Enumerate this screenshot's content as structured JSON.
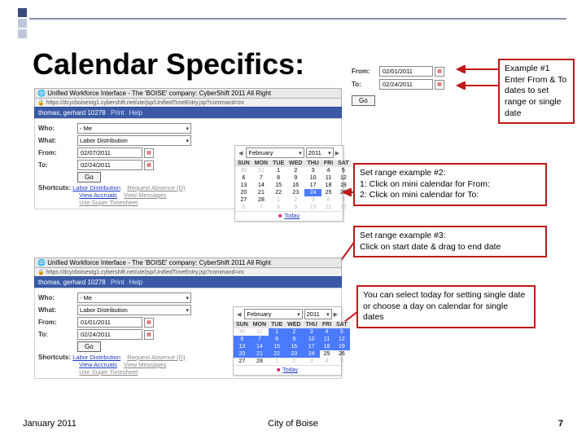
{
  "title": "Calendar Specifics:",
  "footer": {
    "date": "January 2011",
    "city": "City of Boise",
    "page": "7"
  },
  "ann1": "Example #1\nEnter From & To dates to set range or single date",
  "ann2": "Set range example #2:\n1:  Click on mini calendar for From:\n2:  Click on mini calendar for To:",
  "ann3": "Set range example #3:\nClick on start date & drag to end date",
  "ann4": "You can select today for setting single date or choose a day on calendar for single dates",
  "shot_top": {
    "ie_title": "Unified Workforce Interface - The 'BOISE' company: CyberShift 2011 All Right",
    "url": "https://dcycboisestg1.cybershift.net/ute/jsp/UnifiedTimeEntry.jsp?command=ini",
    "user": "thomas, gerhard 10278",
    "user_links": [
      "Print",
      "Help"
    ],
    "who_label": "Who:",
    "who_value": "- Me",
    "what_label": "What:",
    "what_value": "Labor Distribution",
    "from_label": "From:",
    "from_value": "02/07/2011",
    "to_label": "To:",
    "to_value": "02/24/2011",
    "go": "Go",
    "sc_label": "Shortcuts:",
    "sc_links": [
      "Labor Distribution",
      "Request Absence (D)",
      "View Accruals",
      "View Messages",
      "Use Super Timesheet"
    ]
  },
  "cal1": {
    "month": "February",
    "year": "2011",
    "dow": [
      "SUN",
      "MON",
      "TUE",
      "WED",
      "THU",
      "FRI",
      "SAT"
    ],
    "rows": [
      [
        {
          "d": "30",
          "off": 1
        },
        {
          "d": "31",
          "off": 1
        },
        {
          "d": "1"
        },
        {
          "d": "2"
        },
        {
          "d": "3"
        },
        {
          "d": "4"
        },
        {
          "d": "5"
        }
      ],
      [
        {
          "d": "6"
        },
        {
          "d": "7"
        },
        {
          "d": "8"
        },
        {
          "d": "9"
        },
        {
          "d": "10"
        },
        {
          "d": "11"
        },
        {
          "d": "12"
        }
      ],
      [
        {
          "d": "13"
        },
        {
          "d": "14"
        },
        {
          "d": "15"
        },
        {
          "d": "16"
        },
        {
          "d": "17"
        },
        {
          "d": "18"
        },
        {
          "d": "19"
        }
      ],
      [
        {
          "d": "20"
        },
        {
          "d": "21"
        },
        {
          "d": "22"
        },
        {
          "d": "23"
        },
        {
          "d": "24",
          "sel": 1
        },
        {
          "d": "25"
        },
        {
          "d": "26"
        }
      ],
      [
        {
          "d": "27"
        },
        {
          "d": "28"
        },
        {
          "d": "1",
          "off": 1
        },
        {
          "d": "2",
          "off": 1
        },
        {
          "d": "3",
          "off": 1
        },
        {
          "d": "4",
          "off": 1
        },
        {
          "d": "5",
          "off": 1
        }
      ],
      [
        {
          "d": "6",
          "off": 1
        },
        {
          "d": "7",
          "off": 1
        },
        {
          "d": "8",
          "off": 1
        },
        {
          "d": "9",
          "off": 1
        },
        {
          "d": "10",
          "off": 1
        },
        {
          "d": "11",
          "off": 1
        },
        {
          "d": "12",
          "off": 1
        }
      ]
    ],
    "today": "Today"
  },
  "frag": {
    "from_label": "From:",
    "from_value": "02/01/2011",
    "to_label": "To:",
    "to_value": "02/24/2011",
    "go": "Go"
  },
  "shot_bot": {
    "ie_title": "Unified Workforce Interface - The 'BOISE' company: CyberShift 2011 All Right",
    "url": "https://dcycboisestg1.cybershift.net/ute/jsp/UnifiedTimeEntry.jsp?command=ini",
    "user": "thomas, gerhard 10278",
    "user_links": [
      "Print",
      "Help"
    ],
    "who_label": "Who:",
    "who_value": "- Me",
    "what_label": "What:",
    "what_value": "Labor Distribution",
    "from_label": "From:",
    "from_value": "01/01/2011",
    "to_label": "To:",
    "to_value": "02/24/2011",
    "go": "Go",
    "sc_label": "Shortcuts:",
    "sc_links": [
      "Labor Distribution",
      "Request Absence (D)",
      "View Accruals",
      "View Messages",
      "Use Super Timesheet"
    ]
  },
  "cal2": {
    "month": "February",
    "year": "2011",
    "dow": [
      "SUN",
      "MON",
      "TUE",
      "WED",
      "THU",
      "FRI",
      "SAT"
    ],
    "rows": [
      [
        {
          "d": "30",
          "off": 1
        },
        {
          "d": "31",
          "off": 1
        },
        {
          "d": "1",
          "sel": 1
        },
        {
          "d": "2",
          "sel": 1
        },
        {
          "d": "3",
          "sel": 1
        },
        {
          "d": "4",
          "sel": 1
        },
        {
          "d": "5",
          "sel": 1
        }
      ],
      [
        {
          "d": "6",
          "sel": 1
        },
        {
          "d": "7",
          "sel": 1
        },
        {
          "d": "8",
          "sel": 1
        },
        {
          "d": "9",
          "sel": 1
        },
        {
          "d": "10",
          "sel": 1
        },
        {
          "d": "11",
          "sel": 1
        },
        {
          "d": "12",
          "sel": 1
        }
      ],
      [
        {
          "d": "13",
          "sel": 1
        },
        {
          "d": "14",
          "sel": 1
        },
        {
          "d": "15",
          "sel": 1
        },
        {
          "d": "16",
          "sel": 1
        },
        {
          "d": "17",
          "sel": 1
        },
        {
          "d": "18",
          "sel": 1
        },
        {
          "d": "19",
          "sel": 1
        }
      ],
      [
        {
          "d": "20",
          "sel": 1
        },
        {
          "d": "21",
          "sel": 1
        },
        {
          "d": "22",
          "sel": 1
        },
        {
          "d": "23",
          "sel": 1
        },
        {
          "d": "24",
          "sel": 1
        },
        {
          "d": "25"
        },
        {
          "d": "26"
        }
      ],
      [
        {
          "d": "27"
        },
        {
          "d": "28"
        },
        {
          "d": "1",
          "off": 1
        },
        {
          "d": "2",
          "off": 1
        },
        {
          "d": "3",
          "off": 1
        },
        {
          "d": "4",
          "off": 1
        },
        {
          "d": "5",
          "off": 1
        }
      ]
    ],
    "today": "Today"
  }
}
